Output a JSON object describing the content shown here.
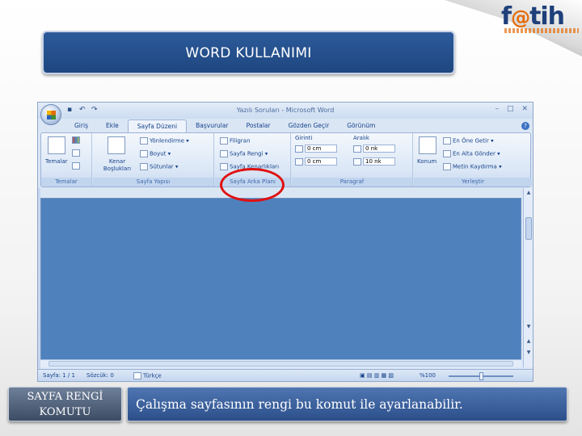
{
  "brand": {
    "logo_text": "f@tih"
  },
  "slide": {
    "title": "WORD KULLANIMI"
  },
  "word": {
    "window_title": "Yazılı Soruları - Microsoft Word",
    "qat_icons": [
      "save-icon",
      "undo-icon",
      "redo-icon"
    ],
    "tabs": [
      "Giriş",
      "Ekle",
      "Sayfa Düzeni",
      "Başvurular",
      "Postalar",
      "Gözden Geçir",
      "Görünüm"
    ],
    "active_tab": "Sayfa Düzeni",
    "ribbon": {
      "themes": {
        "label": "Temalar",
        "button": "Temalar"
      },
      "page_setup": {
        "label": "Sayfa Yapısı",
        "margins": "Kenar Boşlukları",
        "orientation": "Yönlendirme",
        "size": "Boyut",
        "columns": "Sütunlar"
      },
      "page_background": {
        "label": "Sayfa Arka Planı",
        "watermark": "Filigran",
        "page_color": "Sayfa Rengi",
        "page_borders": "Sayfa Kenarlıkları"
      },
      "paragraph": {
        "label": "Paragraf",
        "indent_header": "Girinti",
        "spacing_header": "Aralık",
        "indent_left": "0 cm",
        "indent_right": "0 cm",
        "spacing_before": "0 nk",
        "spacing_after": "10 nk"
      },
      "arrange": {
        "label": "Yerleştir",
        "position": "Konum",
        "bring_front": "En Öne Getir",
        "send_back": "En Alta Gönder",
        "text_wrap": "Metin Kaydırma"
      }
    },
    "status": {
      "page": "Sayfa: 1 / 1",
      "words": "Sözcük: 0",
      "language": "Türkçe",
      "zoom": "%100"
    }
  },
  "footer": {
    "command_label_line1": "SAYFA RENGİ",
    "command_label_line2": "KOMUTU",
    "description": "Çalışma sayfasının rengi bu komut ile ayarlanabilir."
  },
  "colors": {
    "page_color": "#4f81bd",
    "title_banner": "#1f4780",
    "highlight": "#e01010"
  }
}
